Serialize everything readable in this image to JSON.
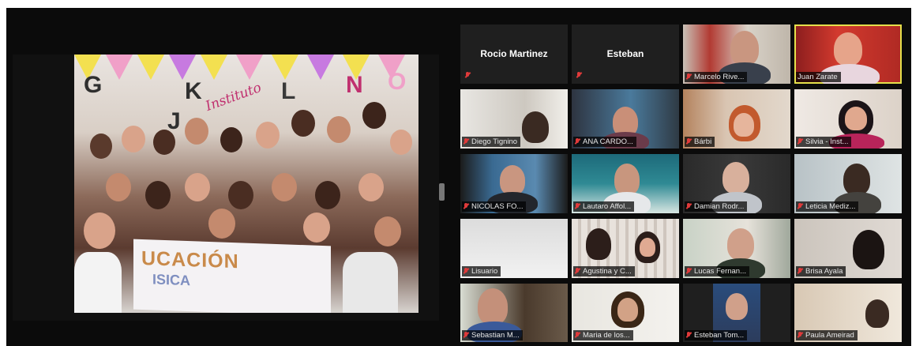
{
  "shared_screen": {
    "wall_letters": [
      "G",
      "K",
      "L",
      "N",
      "O",
      "J"
    ],
    "wall_text": "Instituto",
    "banner_line1": "UCACIÓN",
    "banner_line2": "ISICA"
  },
  "gallery": {
    "tiles": [
      {
        "name": "Rocio Martinez",
        "video": false
      },
      {
        "name": "Esteban",
        "video": false
      },
      {
        "name": "Marcelo Rive...",
        "video": true
      },
      {
        "name": "Juan Zarate",
        "video": true,
        "active": true
      },
      {
        "name": "Diego Tignino",
        "video": true
      },
      {
        "name": "ANA CARDO...",
        "video": true
      },
      {
        "name": "Bárbi",
        "video": true
      },
      {
        "name": "Silvia - Inst...",
        "video": true
      },
      {
        "name": "NICOLAS FO...",
        "video": true
      },
      {
        "name": "Lautaro Affol...",
        "video": true
      },
      {
        "name": "Damian Rodr...",
        "video": true
      },
      {
        "name": "Leticia Mediz...",
        "video": true
      },
      {
        "name": "Lisuario",
        "video": true
      },
      {
        "name": "Agustina y C...",
        "video": true
      },
      {
        "name": "Lucas Fernan...",
        "video": true
      },
      {
        "name": "Brisa Ayala",
        "video": true
      },
      {
        "name": "Sebastian M...",
        "video": true
      },
      {
        "name": "Maria de los...",
        "video": true
      },
      {
        "name": "Esteban Tom...",
        "video": true
      },
      {
        "name": "Paula Ameirad",
        "video": true
      }
    ]
  },
  "colors": {
    "background": "#0b0b0b",
    "active_speaker_border": "#e5e04b",
    "muted_icon": "#e03a3a"
  },
  "icons": {
    "tile_muted": "microphone-muted-icon"
  }
}
